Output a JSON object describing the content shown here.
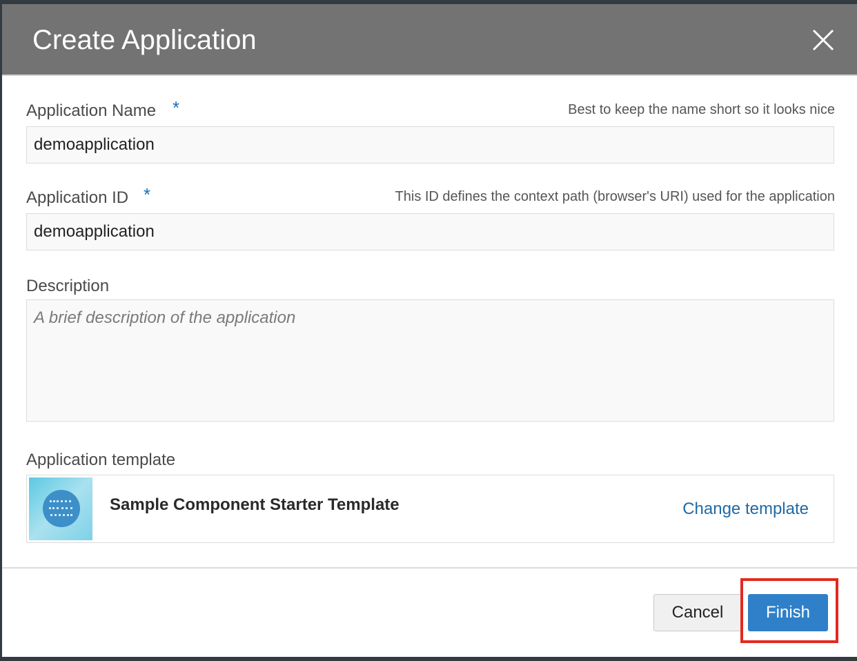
{
  "dialog": {
    "title": "Create Application",
    "close_icon": "close-icon"
  },
  "fields": {
    "app_name": {
      "label": "Application Name",
      "required_mark": "*",
      "hint": "Best to keep the name short so it looks nice",
      "value": "demoapplication"
    },
    "app_id": {
      "label": "Application ID",
      "required_mark": "*",
      "hint": "This ID defines the context path (browser's URI) used for the application",
      "value": "demoapplication"
    },
    "description": {
      "label": "Description",
      "placeholder": "A brief description of the application",
      "value": ""
    }
  },
  "template": {
    "label": "Application template",
    "name": "Sample Component Starter Template",
    "change_label": "Change template"
  },
  "footer": {
    "cancel_label": "Cancel",
    "finish_label": "Finish"
  },
  "colors": {
    "header_bg": "#737373",
    "accent": "#2f80c9",
    "link": "#1f6aa6",
    "highlight": "#e3291e"
  }
}
